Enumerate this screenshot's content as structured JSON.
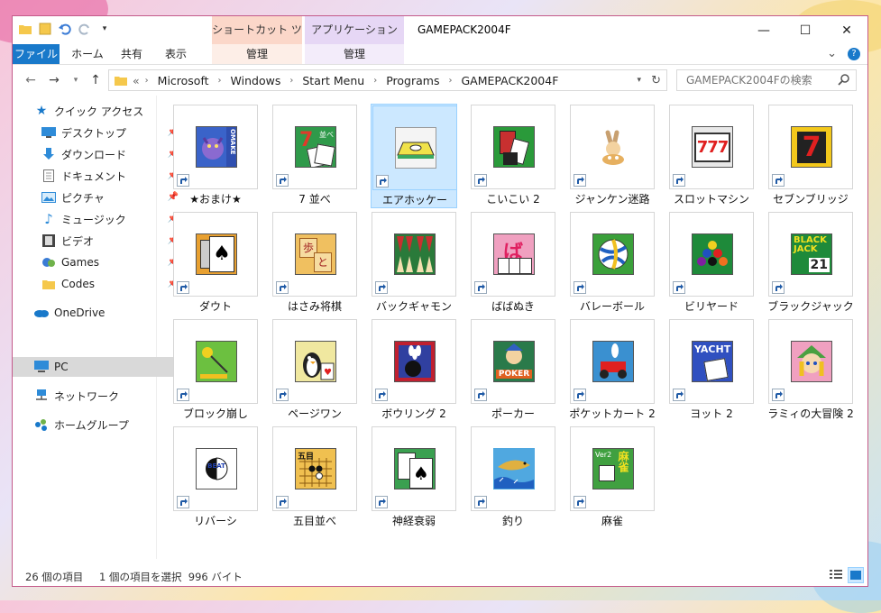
{
  "window": {
    "title": "GAMEPACK2004F",
    "context_tab_shortcut": "ショートカット ツール",
    "context_tab_app": "アプリケーション ツール",
    "context_sub_shortcut": "管理",
    "context_sub_app": "管理",
    "controls": {
      "minimize": "—",
      "maximize": "☐",
      "close": "✕"
    }
  },
  "ribbon": {
    "tabs": [
      "ファイル",
      "ホーム",
      "共有",
      "表示"
    ],
    "collapse": "⌄",
    "help": "?"
  },
  "address": {
    "overflow": "«",
    "crumbs": [
      "Microsoft",
      "Windows",
      "Start Menu",
      "Programs",
      "GAMEPACK2004F"
    ],
    "search_placeholder": "GAMEPACK2004Fの検索"
  },
  "nav": {
    "quick_access": "クイック アクセス",
    "items": [
      {
        "label": "デスクトップ",
        "icon": "desktop-icon"
      },
      {
        "label": "ダウンロード",
        "icon": "download-icon"
      },
      {
        "label": "ドキュメント",
        "icon": "document-icon"
      },
      {
        "label": "ピクチャ",
        "icon": "pictures-icon"
      },
      {
        "label": "ミュージック",
        "icon": "music-icon"
      },
      {
        "label": "ビデオ",
        "icon": "video-icon"
      },
      {
        "label": "Games",
        "icon": "games-folder-icon"
      },
      {
        "label": "Codes",
        "icon": "folder-icon"
      }
    ],
    "onedrive": "OneDrive",
    "pc": "PC",
    "network": "ネットワーク",
    "homegroup": "ホームグループ"
  },
  "files": [
    {
      "label": "★おまけ★"
    },
    {
      "label": "7 並べ"
    },
    {
      "label": "エアホッケー",
      "selected": true
    },
    {
      "label": "こいこい 2"
    },
    {
      "label": "ジャンケン迷路"
    },
    {
      "label": "スロットマシン"
    },
    {
      "label": "セブンブリッジ"
    },
    {
      "label": "ダウト"
    },
    {
      "label": "はさみ将棋"
    },
    {
      "label": "バックギャモン"
    },
    {
      "label": "ばばぬき"
    },
    {
      "label": "バレーボール"
    },
    {
      "label": "ビリヤード"
    },
    {
      "label": "ブラックジャック"
    },
    {
      "label": "ブロック崩し"
    },
    {
      "label": "ページワン"
    },
    {
      "label": "ボウリング 2"
    },
    {
      "label": "ポーカー"
    },
    {
      "label": "ポケットカート 2"
    },
    {
      "label": "ヨット 2"
    },
    {
      "label": "ラミィの大冒険 2"
    },
    {
      "label": "リバーシ"
    },
    {
      "label": "五目並べ"
    },
    {
      "label": "神経衰弱"
    },
    {
      "label": "釣り"
    },
    {
      "label": "麻雀"
    }
  ],
  "icon_text": {
    "omake": "OMAKE",
    "seven": "7",
    "narabe": "並べ",
    "slot": "777",
    "blackjack": "BLACK JACK",
    "bj21": "21",
    "poker": "POKER",
    "yacht": "YACHT",
    "reversi": "BEAT REVERSI",
    "gomoku": "五目",
    "ver2": "Ver2",
    "mahjong": "麻雀",
    "shogi1": "歩",
    "shogi2": "と",
    "baba": "ば"
  },
  "status": {
    "count": "26 個の項目",
    "selection": "1 個の項目を選択  996 バイト"
  },
  "colors": {
    "accent": "#1979ca",
    "selection": "#cce8ff",
    "border": "#c45a8a"
  }
}
